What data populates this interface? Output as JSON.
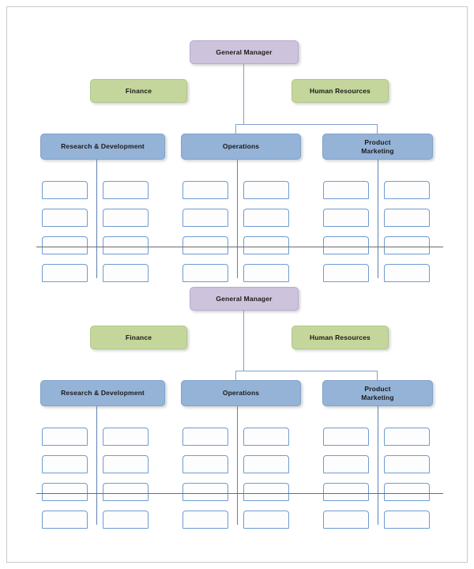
{
  "document": {
    "type": "organizational-chart-template",
    "chart_count": 2
  },
  "charts": [
    {
      "id": "org-chart-1",
      "executive": {
        "label": "General Manager",
        "color": "#cec3dd"
      },
      "staff": [
        {
          "label": "Finance",
          "color": "#c4d69b",
          "side": "left"
        },
        {
          "label": "Human Resources",
          "color": "#c4d69b",
          "side": "right"
        }
      ],
      "departments": [
        {
          "label": "Research & Development",
          "color": "#95b3d7"
        },
        {
          "label": "Operations",
          "color": "#95b3d7"
        },
        {
          "label": "Product Marketing",
          "color": "#95b3d7"
        }
      ],
      "grid": {
        "columns": 6,
        "rows": 4,
        "cell_label": "",
        "outline_color": "#6f9bd1"
      }
    },
    {
      "id": "org-chart-2",
      "executive": {
        "label": "General Manager",
        "color": "#cec3dd"
      },
      "staff": [
        {
          "label": "Finance",
          "color": "#c4d69b",
          "side": "left"
        },
        {
          "label": "Human Resources",
          "color": "#c4d69b",
          "side": "right"
        }
      ],
      "departments": [
        {
          "label": "Research & Development",
          "color": "#95b3d7"
        },
        {
          "label": "Operations",
          "color": "#95b3d7"
        },
        {
          "label": "Product Marketing",
          "color": "#95b3d7"
        }
      ],
      "grid": {
        "columns": 6,
        "rows": 4,
        "cell_label": "",
        "outline_color": "#6f9bd1"
      }
    }
  ]
}
